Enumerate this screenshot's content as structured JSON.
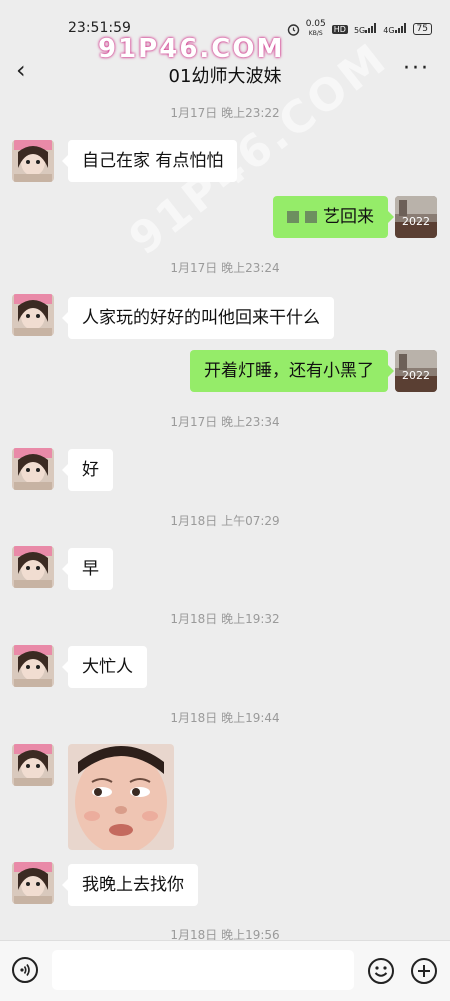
{
  "status": {
    "time": "23:51:59",
    "speed": "0.05",
    "speed_unit": "KB/S",
    "hd": "HD",
    "net1": "5G",
    "net2": "4G",
    "battery": "75"
  },
  "header": {
    "title": "01幼师大波妹",
    "back_glyph": "‹",
    "more_glyph": "···"
  },
  "watermark": {
    "top": "91P46.COM",
    "diagonal": "91P46.COM"
  },
  "messages": [
    {
      "type": "time",
      "text": "1月17日 晚上23:22"
    },
    {
      "type": "in",
      "text": "自己在家 有点怕怕"
    },
    {
      "type": "out",
      "text": "艺回来"
    },
    {
      "type": "time",
      "text": "1月17日 晚上23:24"
    },
    {
      "type": "in",
      "text": "人家玩的好好的叫他回来干什么"
    },
    {
      "type": "out",
      "text": "开着灯睡，还有小黑了"
    },
    {
      "type": "time",
      "text": "1月17日 晚上23:34"
    },
    {
      "type": "in",
      "text": "好"
    },
    {
      "type": "time",
      "text": "1月18日 上午07:29"
    },
    {
      "type": "in",
      "text": "早"
    },
    {
      "type": "time",
      "text": "1月18日 晚上19:32"
    },
    {
      "type": "in",
      "text": "大忙人"
    },
    {
      "type": "time",
      "text": "1月18日 晚上19:44"
    },
    {
      "type": "in",
      "text": "我晚上去找你"
    },
    {
      "type": "time",
      "text": "1月18日 晚上19:56"
    }
  ],
  "avatar_right_label": "2022",
  "icons": {
    "back": "back-arrow-icon",
    "more": "more-icon",
    "voice": "voice-icon",
    "emoji": "emoji-icon",
    "plus": "plus-icon"
  },
  "colors": {
    "background": "#ededed",
    "incoming": "#ffffff",
    "outgoing": "#95ec69",
    "timestamp": "#9a9a9a"
  }
}
